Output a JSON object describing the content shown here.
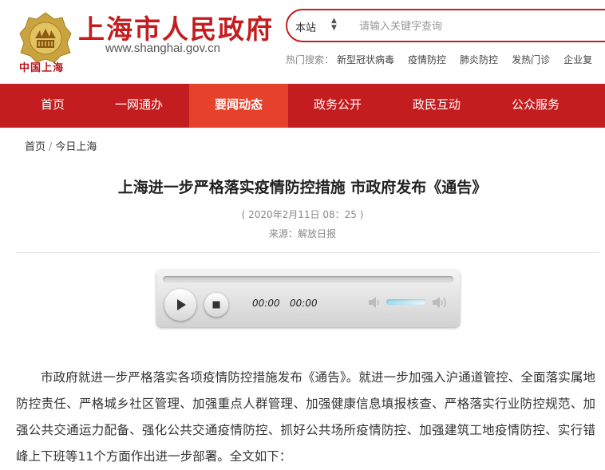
{
  "header": {
    "site_title": "上海市人民政府",
    "site_domain": "www.shanghai.gov.cn",
    "logo_caption": "中国上海",
    "logo_icon": "shanghai-city-emblem-icon",
    "brand_color": "#c41d1f"
  },
  "search": {
    "scope": "本站",
    "placeholder": "请输入关键字查询"
  },
  "hot_search": {
    "label": "热门搜索：",
    "keywords": [
      "新型冠状病毒",
      "疫情防控",
      "肺炎防控",
      "发热门诊",
      "企业复"
    ]
  },
  "nav": {
    "items": [
      "首页",
      "一网通办",
      "要闻动态",
      "政务公开",
      "政民互动",
      "公众服务"
    ],
    "active_index": 2,
    "active_color": "#e6412b"
  },
  "breadcrumb": {
    "home": "首页",
    "separator": "/",
    "current": "今日上海"
  },
  "article": {
    "title": "上海进一步严格落实疫情防控措施 市政府发布《通告》",
    "date": "( 2020年2月11日 08：25 )",
    "source": "来源：解放日报",
    "body": "市政府就进一步严格落实各项疫情防控措施发布《通告》。就进一步加强入沪通道管控、全面落实属地防控责任、严格城乡社区管理、加强重点人群管理、加强健康信息填报核查、严格落实行业防控规范、加强公共交通运力配备、强化公共交通疫情防控、抓好公共场所疫情防控、加强建筑工地疫情防控、实行错峰上下班等11个方面作出进一步部署。全文如下："
  },
  "player": {
    "current_time": "00:00",
    "duration": "00:00",
    "progress": 0,
    "volume": 0.8,
    "icons": [
      "play-icon",
      "stop-icon",
      "volume-min-icon",
      "volume-max-icon"
    ]
  }
}
